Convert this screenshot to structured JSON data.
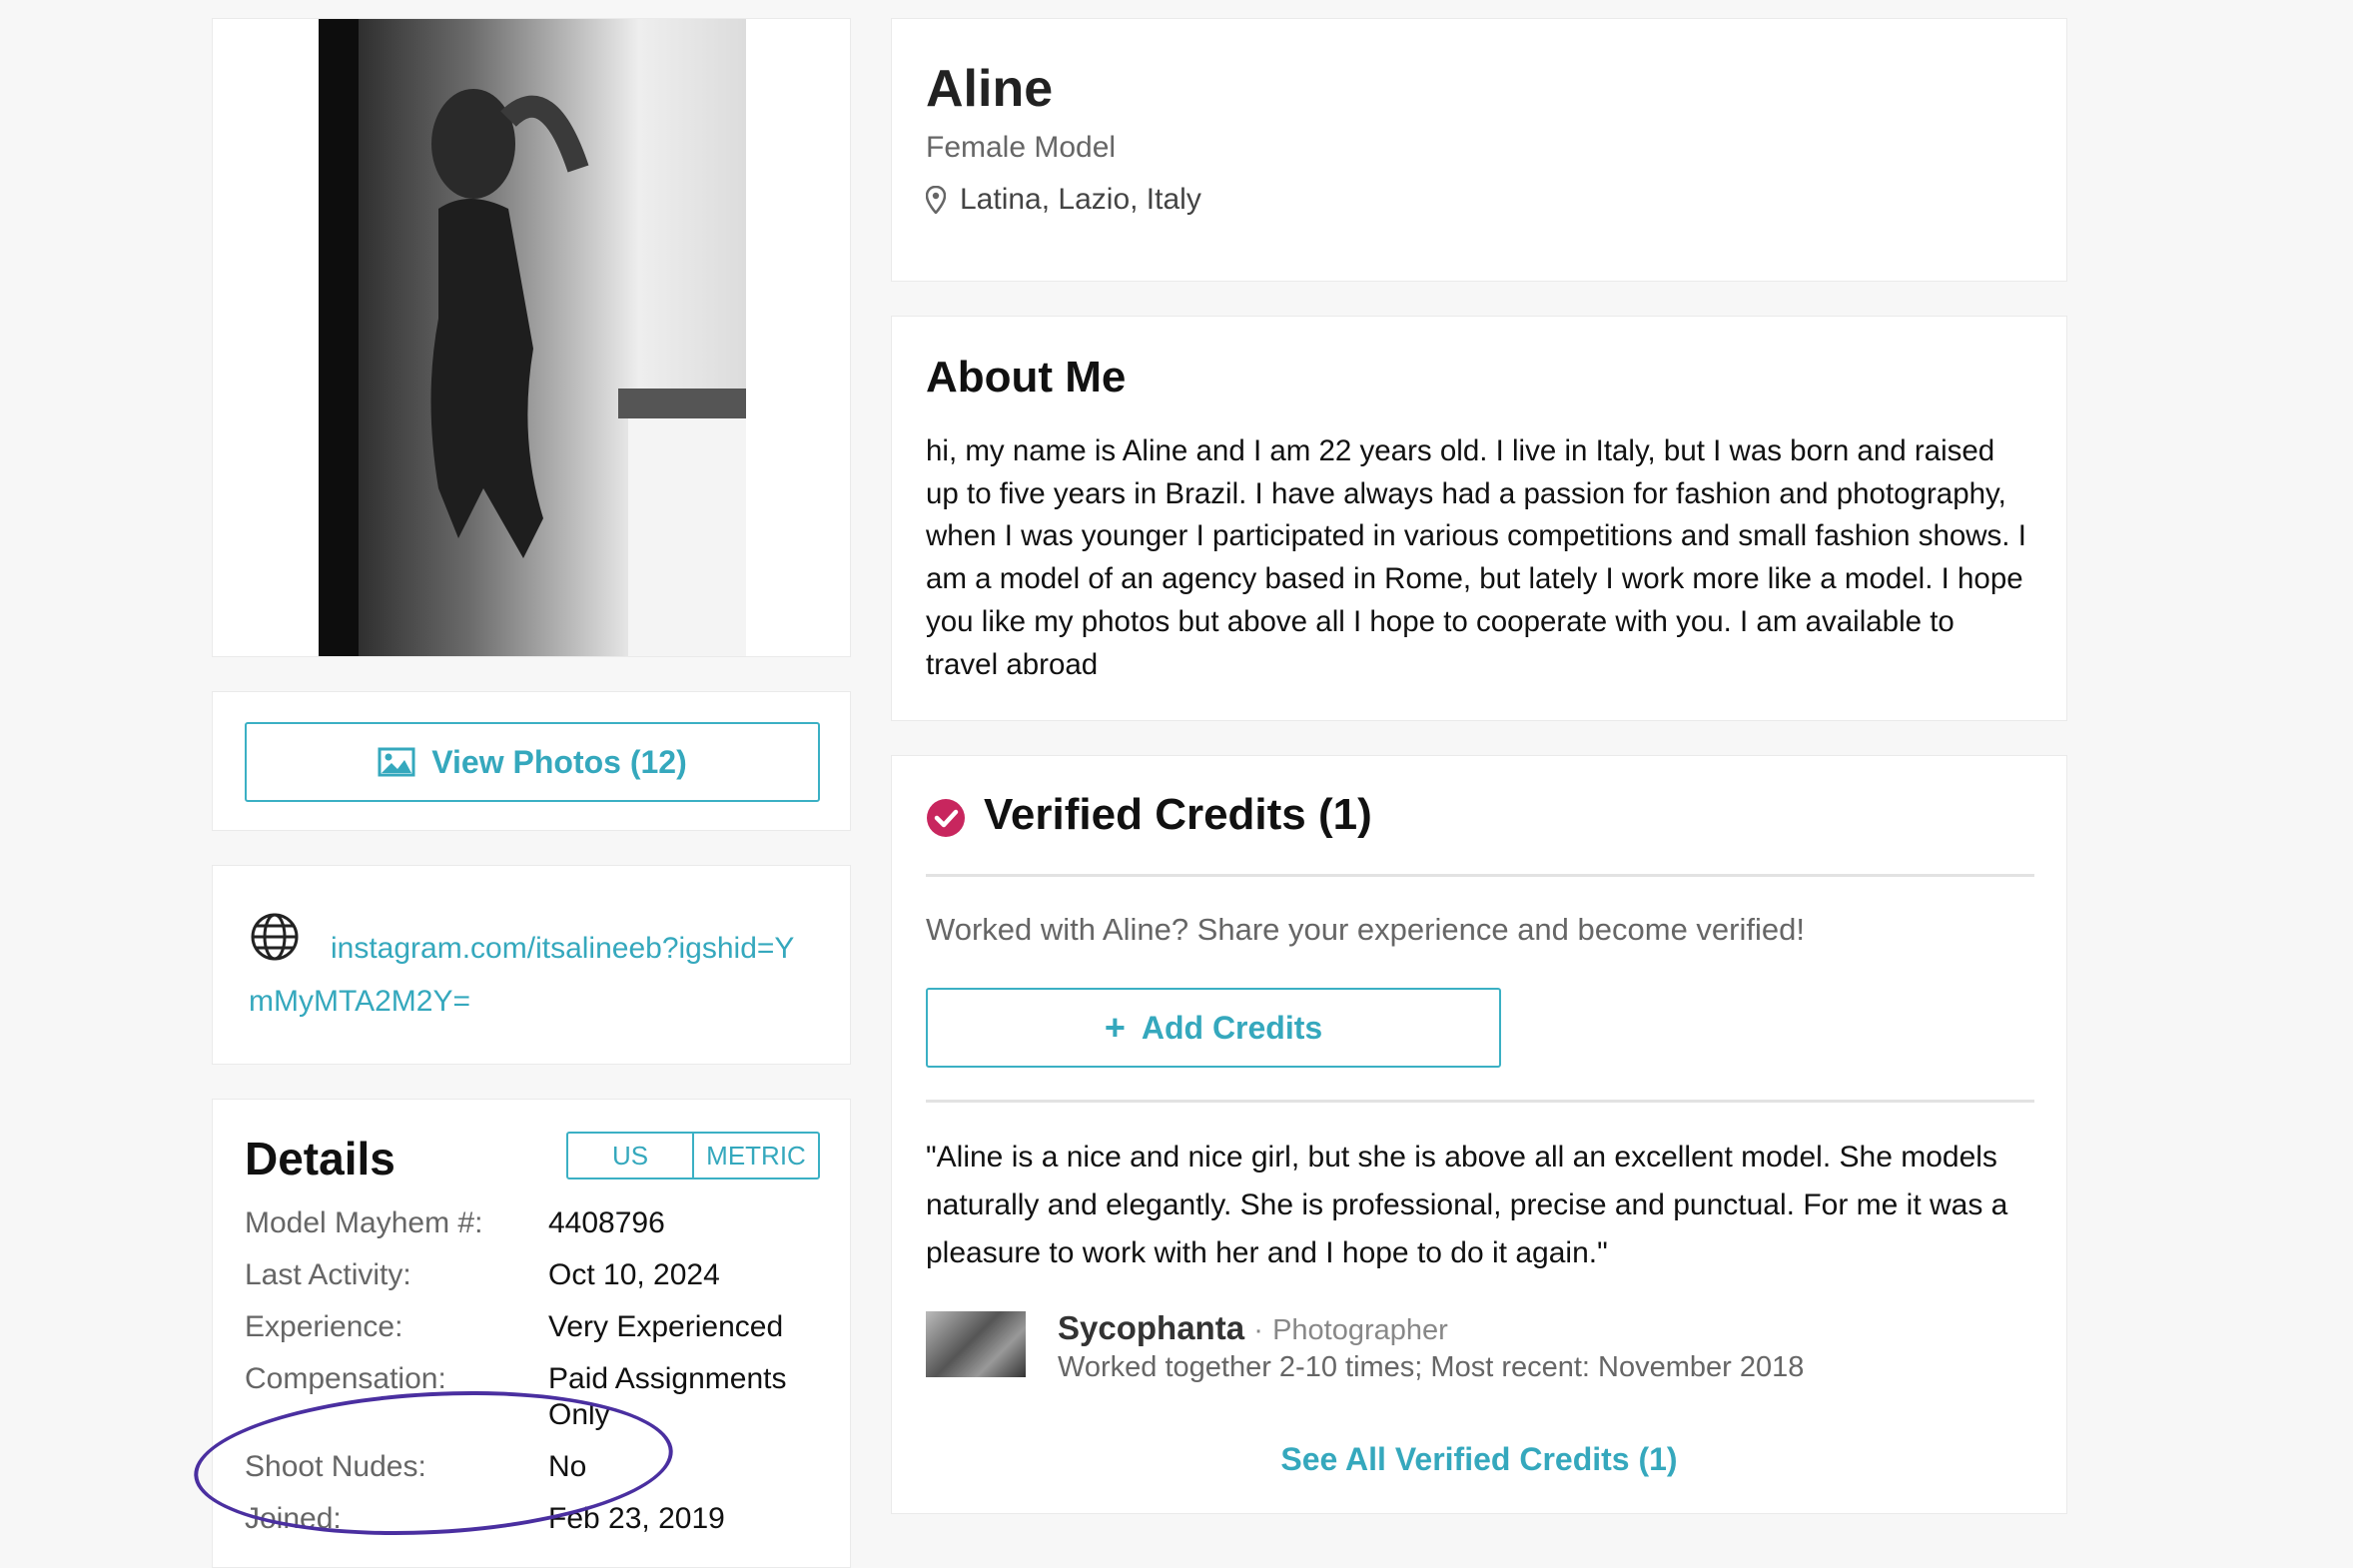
{
  "profile": {
    "name": "Aline",
    "role": "Female Model",
    "location": "Latina, Lazio, Italy"
  },
  "sidebar": {
    "view_photos_label": "View Photos (12)",
    "website_link": "instagram.com/itsalineeb?igshid=YmMyMTA2M2Y="
  },
  "details": {
    "title": "Details",
    "unit_us": "US",
    "unit_metric": "METRIC",
    "rows": [
      {
        "label": "Model Mayhem #:",
        "value": "4408796"
      },
      {
        "label": "Last Activity:",
        "value": "Oct 10, 2024"
      },
      {
        "label": "Experience:",
        "value": "Very Experienced"
      },
      {
        "label": "Compensation:",
        "value": "Paid Assignments Only"
      },
      {
        "label": "Shoot Nudes:",
        "value": "No"
      },
      {
        "label": "Joined:",
        "value": "Feb 23, 2019"
      }
    ]
  },
  "about": {
    "title": "About Me",
    "text": "hi, my name is Aline and I am 22 years old. I live in Italy, but I was born and raised up to five years in Brazil. I have always had a passion for fashion and photography, when I was younger I participated in various competitions and small fashion shows. I am a model of an agency based in Rome, but lately I work more like a model. I hope you like my photos but above all I hope to cooperate with you. I am available to travel abroad"
  },
  "credits": {
    "title": "Verified Credits (1)",
    "prompt": "Worked with Aline? Share your experience and become verified!",
    "add_label": "Add Credits",
    "quote": "\"Aline is a nice and nice girl, but she is above all an excellent model. She models naturally and elegantly. She is professional, precise and punctual. For me it was a pleasure to work with her and I hope to do it again.\"",
    "reviewer_name": "Sycophanta",
    "reviewer_sep": "·",
    "reviewer_role": "Photographer",
    "worked_together": "Worked together 2-10 times; Most recent: November 2018",
    "see_all_label": "See All Verified Credits (1)"
  },
  "colors": {
    "accent": "#35a8bd",
    "verified": "#c8265e",
    "annotation": "#4a2fa0"
  },
  "icons": {
    "photos": "image-icon",
    "website": "globe-icon",
    "location": "map-pin-icon",
    "verified": "check-circle-icon",
    "add": "plus-icon"
  }
}
